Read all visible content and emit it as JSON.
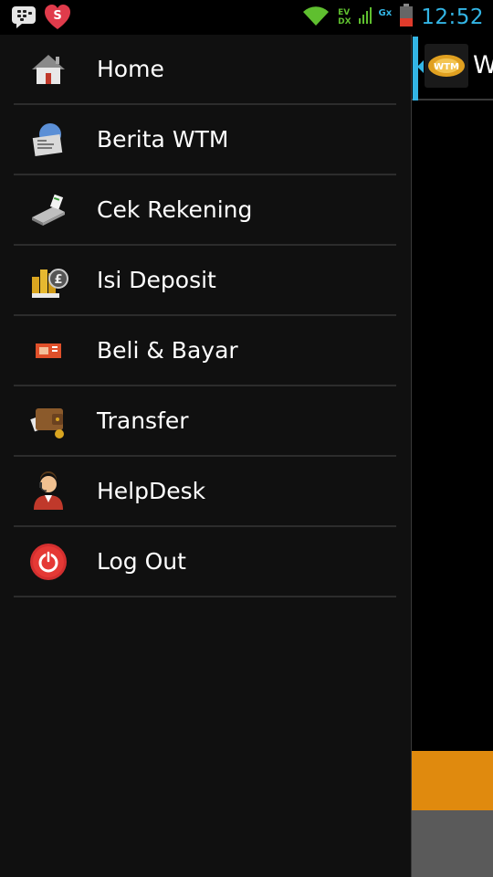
{
  "status_bar": {
    "time": "12:52",
    "net_top": "EV",
    "net_bottom": "DX",
    "gx": "Gx",
    "notification_icons": [
      "bbm-icon",
      "sfree-icon"
    ]
  },
  "drawer": {
    "items": [
      {
        "label": "Home",
        "icon": "home-icon"
      },
      {
        "label": "Berita WTM",
        "icon": "news-icon"
      },
      {
        "label": "Cek Rekening",
        "icon": "card-reader-icon"
      },
      {
        "label": "Isi Deposit",
        "icon": "coins-icon"
      },
      {
        "label": "Beli & Bayar",
        "icon": "sim-card-icon"
      },
      {
        "label": "Transfer",
        "icon": "wallet-icon"
      },
      {
        "label": "HelpDesk",
        "icon": "support-agent-icon"
      },
      {
        "label": "Log Out",
        "icon": "power-icon"
      }
    ]
  },
  "content": {
    "action_bar_title": "W",
    "logo_text": "WTM"
  },
  "colors": {
    "accent": "#33b5e5",
    "drawer_bg": "#101010",
    "divider": "#2c2c2c",
    "orange": "#e08a0e",
    "gray": "#5a5a5a"
  }
}
